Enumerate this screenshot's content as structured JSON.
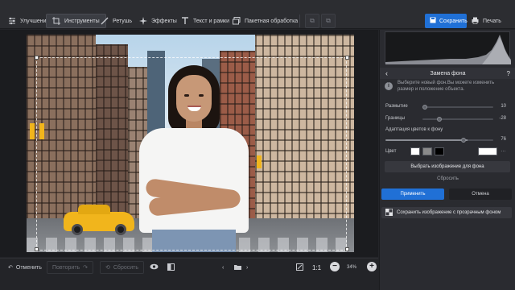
{
  "toolbar": {
    "tabs": [
      {
        "label": "Улучшения",
        "icon": "sliders-icon"
      },
      {
        "label": "Инструменты",
        "icon": "crop-icon",
        "active": true
      },
      {
        "label": "Ретушь",
        "icon": "brush-icon"
      },
      {
        "label": "Эффекты",
        "icon": "sparkle-icon"
      },
      {
        "label": "Текст и рамки",
        "icon": "text-icon"
      },
      {
        "label": "Пакетная обработка",
        "icon": "batch-icon"
      }
    ],
    "save_label": "Сохранить",
    "print_label": "Печать"
  },
  "bottombar": {
    "undo_label": "Отменить",
    "redo_label": "Повторить",
    "reset_label": "Сбросить",
    "ratio_label": "1:1",
    "zoom_value": "34%"
  },
  "panel": {
    "title": "Замена фона",
    "info_text": "Выберите новый фон.Вы можете изменить размер и положение объекта.",
    "sliders": [
      {
        "label": "Размытие",
        "value": "10",
        "fraction": 0.1
      },
      {
        "label": "Границы",
        "value": "-28",
        "fraction": 0.36
      },
      {
        "label": "Адаптация цветов к фону",
        "value": "76",
        "fraction": 0.76
      }
    ],
    "color_label": "Цвет",
    "colors": [
      "#ffffff",
      "#8a8a8a",
      "#000000",
      "#ffffff"
    ],
    "choose_bg_label": "Выбрать изображение для фона",
    "reset_link": "Сбросить",
    "apply_label": "Применить",
    "cancel_label": "Отмена",
    "save_transparent_label": "Сохранить изображение с прозрачным фоном"
  },
  "colors": {
    "accent": "#2070d6",
    "background": "#232428",
    "panel": "#2a2b30"
  }
}
